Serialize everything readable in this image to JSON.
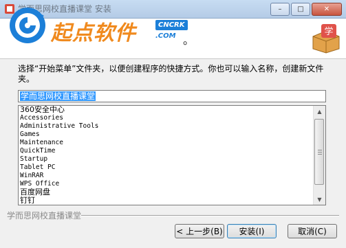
{
  "title_bar": {
    "title": "学而思网校直播课堂 安装",
    "buttons": {
      "minimize": "–",
      "maximize": "□",
      "close": "✕"
    }
  },
  "watermark": {
    "text": "起点软件",
    "badge": "CNCRK",
    "sub": ".COM",
    "suffix": "。"
  },
  "package_icon_glyph": "学",
  "prompt": "选择“开始菜单”文件夹，以便创建程序的快捷方式。你也可以输入名称，创建新文件夹。",
  "folder_name": "学而思网校直播课堂",
  "folders": [
    {
      "label": "360安全中心",
      "font": "cjk"
    },
    {
      "label": "Accessories",
      "font": "mono"
    },
    {
      "label": "Administrative Tools",
      "font": "mono"
    },
    {
      "label": "Games",
      "font": "mono"
    },
    {
      "label": "Maintenance",
      "font": "mono"
    },
    {
      "label": "QuickTime",
      "font": "mono"
    },
    {
      "label": "Startup",
      "font": "mono"
    },
    {
      "label": "Tablet PC",
      "font": "mono"
    },
    {
      "label": "WinRAR",
      "font": "mono"
    },
    {
      "label": "WPS Office",
      "font": "mono"
    },
    {
      "label": "百度网盘",
      "font": "cjk"
    },
    {
      "label": "钉钉",
      "font": "cjk"
    }
  ],
  "brand": "学而思网校直播课堂",
  "buttons": {
    "back": "< 上一步(B)",
    "install": "安装(I)",
    "cancel": "取消(C)"
  },
  "colors": {
    "watermark": "#f08a1e",
    "selection": "#3399ff",
    "badge": "#1c7fd8"
  }
}
